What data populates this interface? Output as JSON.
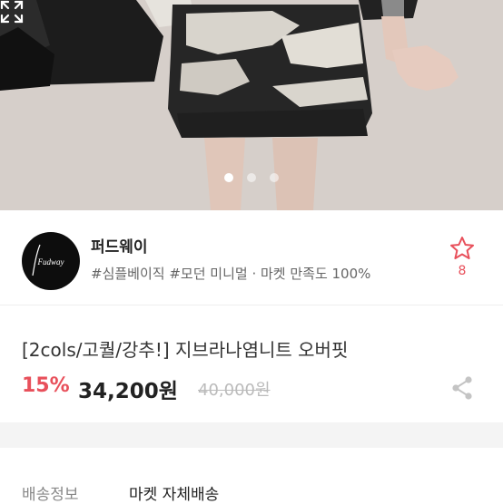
{
  "hero": {
    "image": "product-photo-knit-skirt",
    "carousel": {
      "count": 3,
      "active_index": 0
    },
    "expand_icon": "expand-icon"
  },
  "shop": {
    "logo_text": "Fudway",
    "name": "퍼드웨이",
    "tags": "#심플베이직 #모던 미니멀 · 마켓 만족도 100%",
    "favorite_icon": "star-outline-icon",
    "favorite_count": "8"
  },
  "product": {
    "title": "[2cols/고퀄/강추!] 지브라나염니트 오버핏",
    "discount": "15%",
    "price": "34,200원",
    "original_price": "40,000원",
    "share_icon": "share-icon"
  },
  "shipping": {
    "label": "배송정보",
    "value": "마켓 자체배송"
  },
  "colors": {
    "accent": "#e8505b",
    "text": "#222222",
    "muted": "#888888"
  }
}
